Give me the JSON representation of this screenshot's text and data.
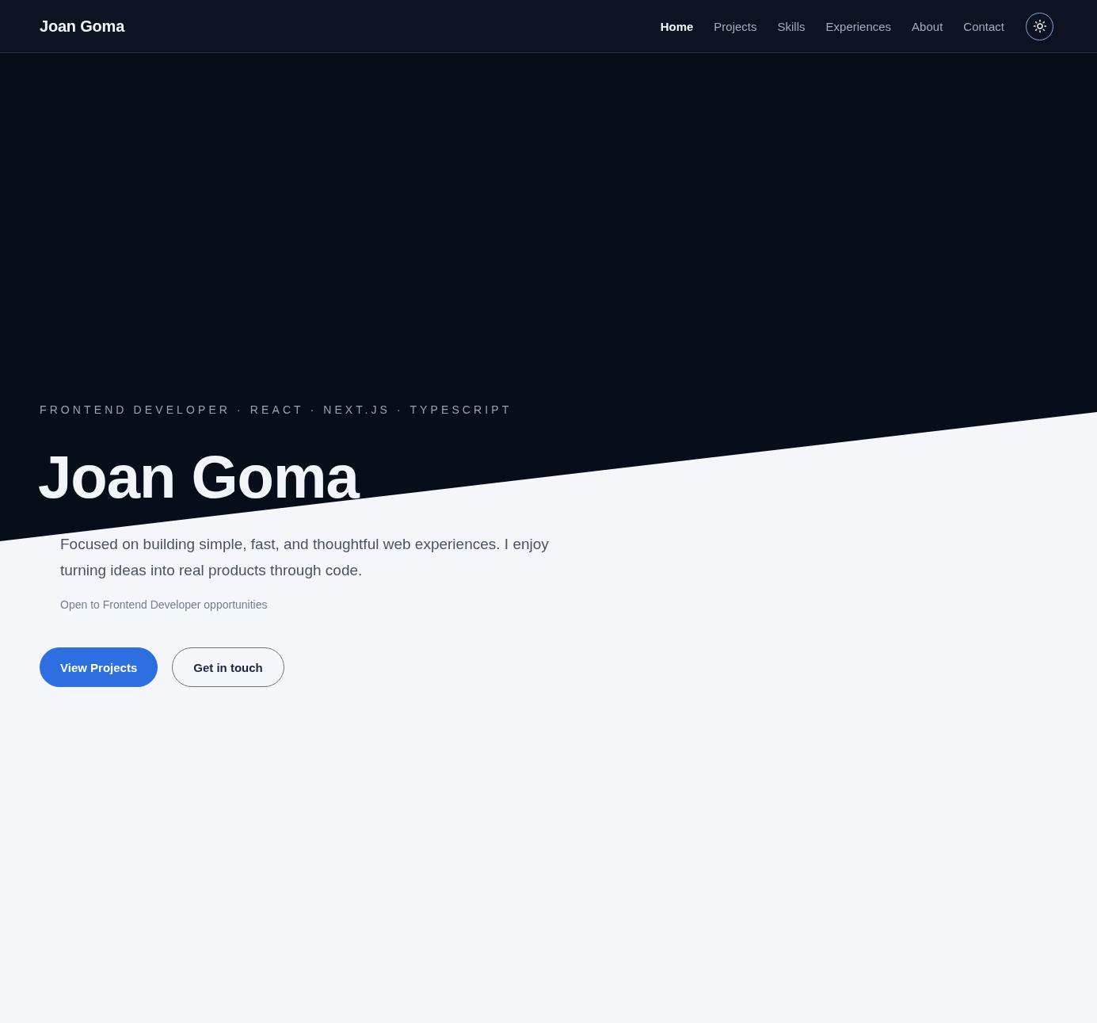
{
  "nav": {
    "brand": "Joan Goma",
    "links": [
      {
        "label": "Home",
        "selected": true
      },
      {
        "label": "Projects",
        "selected": false
      },
      {
        "label": "Skills",
        "selected": false
      },
      {
        "label": "Experiences",
        "selected": false
      },
      {
        "label": "About",
        "selected": false
      },
      {
        "label": "Contact",
        "selected": false
      }
    ]
  },
  "hero": {
    "eyebrow": "FRONTEND DEVELOPER · REACT · NEXT.JS · TYPESCRIPT",
    "title": "Joan Goma",
    "intro": "Focused on building simple, fast, and thoughtful web experiences. I enjoy turning ideas into real products through code.",
    "availability": "Open to Frontend Developer opportunities",
    "buttons": [
      {
        "label": "View Projects",
        "kind": "primary"
      },
      {
        "label": "Get in touch",
        "kind": "secondary"
      }
    ]
  }
}
